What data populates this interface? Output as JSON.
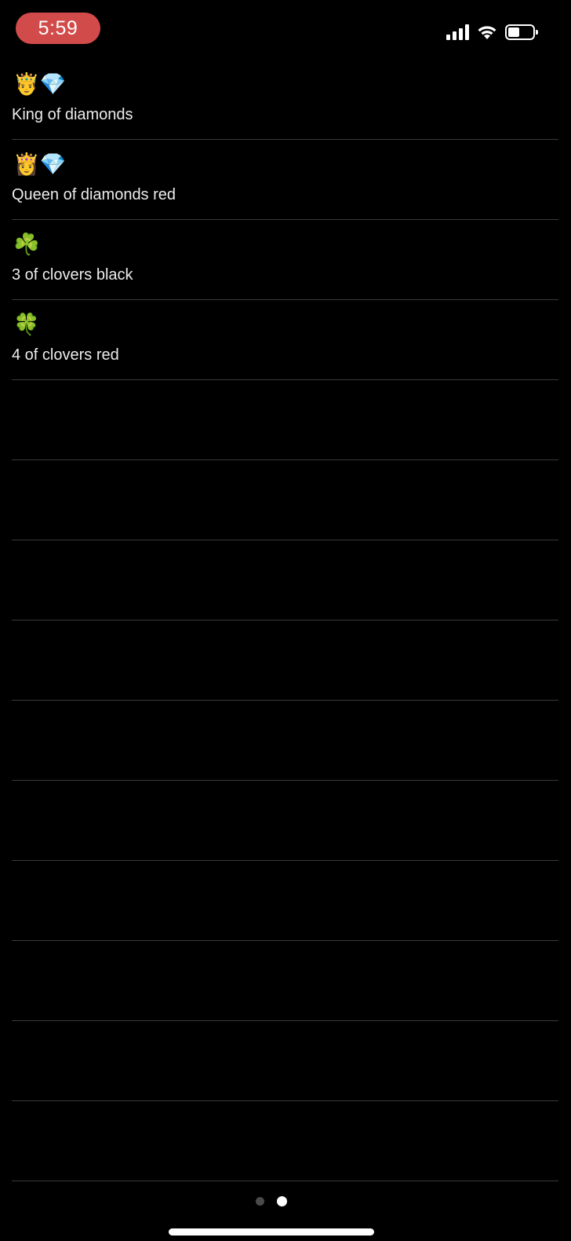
{
  "status_bar": {
    "time": "5:59",
    "signal_icon": "cellular-signal-icon",
    "wifi_icon": "wifi-icon",
    "battery_icon": "battery-icon",
    "battery_level": 0.45,
    "time_pill_color": "#d24b4b"
  },
  "list": {
    "items": [
      {
        "emojis": "🤴💎",
        "label": "King of diamonds"
      },
      {
        "emojis": "👸💎",
        "label": "Queen of diamonds red"
      },
      {
        "emojis": "☘️",
        "label": "3 of clovers black"
      },
      {
        "emojis": "🍀",
        "label": "4 of clovers red"
      },
      {
        "emojis": "",
        "label": ""
      },
      {
        "emojis": "",
        "label": ""
      },
      {
        "emojis": "",
        "label": ""
      },
      {
        "emojis": "",
        "label": ""
      },
      {
        "emojis": "",
        "label": ""
      },
      {
        "emojis": "",
        "label": ""
      },
      {
        "emojis": "",
        "label": ""
      },
      {
        "emojis": "",
        "label": ""
      },
      {
        "emojis": "",
        "label": ""
      },
      {
        "emojis": "",
        "label": ""
      }
    ]
  },
  "pager": {
    "page_count": 2,
    "current_page": 2
  },
  "colors": {
    "background": "#000000",
    "divider": "#3a3a3a",
    "text": "#ececec"
  }
}
